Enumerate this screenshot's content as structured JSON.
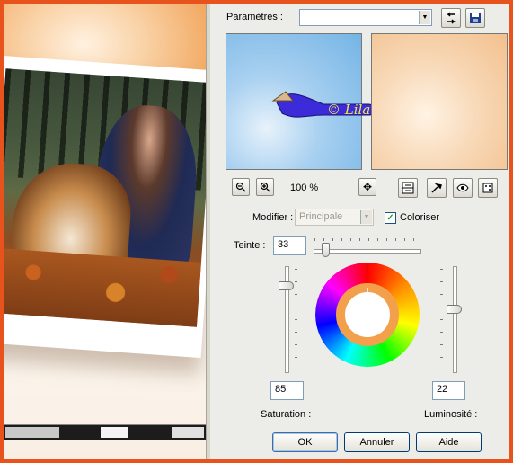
{
  "dialog": {
    "preset_label": "Paramètres :",
    "preset_value": "",
    "zoom_level": "100 %",
    "signature": "© Lila",
    "modifier_label": "Modifier :",
    "modifier_value": "Principale",
    "colorize_label": "Coloriser",
    "colorize_checked": true,
    "hue_label": "Teinte :",
    "hue_value": "33",
    "saturation_value": "85",
    "saturation_label": "Saturation :",
    "lightness_value": "22",
    "lightness_label": "Luminosité :",
    "ok_label": "OK",
    "cancel_label": "Annuler",
    "help_label": "Aide"
  },
  "colors": {
    "frame": "#e8521c",
    "panel": "#ecece8",
    "result_ring": "#f2a04c"
  },
  "icons": [
    "dropdown-arrow-icon",
    "reset-icon",
    "save-icon",
    "zoom-out-icon",
    "zoom-in-icon",
    "pan-icon",
    "preview-toggle-icon",
    "eyedropper-icon",
    "eye-icon",
    "random-icon"
  ]
}
